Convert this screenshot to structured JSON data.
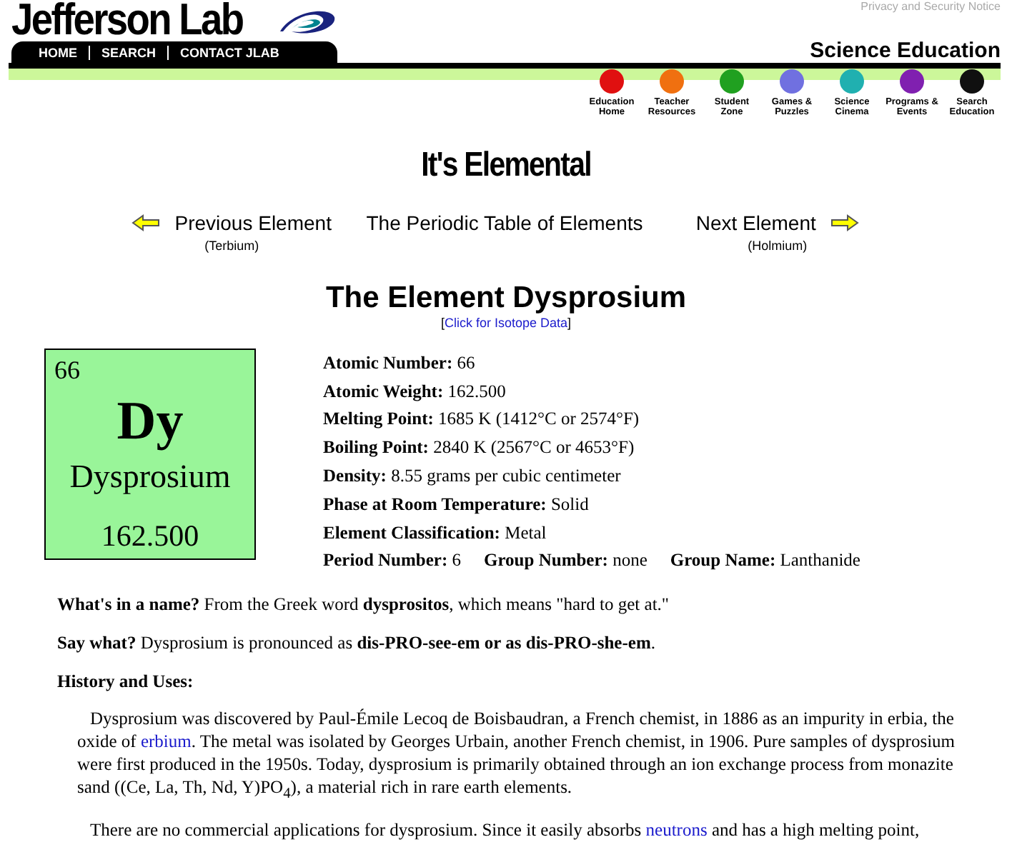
{
  "header": {
    "logo": "Jefferson Lab",
    "privacy_link": "Privacy and Security Notice",
    "nav": [
      {
        "label": "HOME"
      },
      {
        "label": "SEARCH"
      },
      {
        "label": "CONTACT JLAB"
      }
    ],
    "section_title": "Science Education",
    "icon_links": [
      {
        "label": "Education Home",
        "color": "#e01010"
      },
      {
        "label": "Teacher Resources",
        "color": "#f07010"
      },
      {
        "label": "Student Zone",
        "color": "#20a020"
      },
      {
        "label": "Games & Puzzles",
        "color": "#7070e0"
      },
      {
        "label": "Science Cinema",
        "color": "#20b0b0"
      },
      {
        "label": "Programs & Events",
        "color": "#8020b0"
      },
      {
        "label": "Search Education",
        "color": "#101010"
      }
    ]
  },
  "page_title": "It's Elemental",
  "element_nav": {
    "previous": {
      "label": "Previous Element",
      "sub": "(Terbium)"
    },
    "center": "The Periodic Table of Elements",
    "next": {
      "label": "Next Element",
      "sub": "(Holmium)"
    }
  },
  "heading": "The Element Dysprosium",
  "isotope": {
    "open": "[",
    "link": "Click for Isotope Data",
    "close": "]"
  },
  "card": {
    "number": "66",
    "symbol": "Dy",
    "name": "Dysprosium",
    "weight": "162.500"
  },
  "facts": [
    [
      {
        "label": "Atomic Number:",
        "value": "66"
      }
    ],
    [
      {
        "label": "Atomic Weight:",
        "value": "162.500"
      }
    ],
    [
      {
        "label": "Melting Point:",
        "value": "1685 K (1412°C or 2574°F)"
      }
    ],
    [
      {
        "label": "Boiling Point:",
        "value": "2840 K (2567°C or 4653°F)"
      }
    ],
    [
      {
        "label": "Density:",
        "value": "8.55 grams per cubic centimeter"
      }
    ],
    [
      {
        "label": "Phase at Room Temperature:",
        "value": "Solid"
      }
    ],
    [
      {
        "label": "Element Classification:",
        "value": "Metal"
      }
    ],
    [
      {
        "label": "Period Number:",
        "value": "6"
      },
      {
        "label": "Group Number:",
        "value": "none"
      },
      {
        "label": "Group Name:",
        "value": "Lanthanide"
      }
    ]
  ],
  "body": [
    {
      "kind": "line",
      "text": "**What's in a name?** From the Greek word **dysprositos**, which means \"hard to get at.\""
    },
    {
      "kind": "line",
      "text": "**Say what?** Dysprosium is pronounced as **dis-PRO-see-em or as dis-PRO-she-em**."
    },
    {
      "kind": "heading",
      "text": "History and Uses:"
    },
    {
      "kind": "para",
      "segments": [
        {
          "kind": "text",
          "text": "Dysprosium was discovered by Paul-Émile Lecoq de Boisbaudran, a French chemist, in 1886 as an impurity in erbia, the oxide of "
        },
        {
          "kind": "link",
          "text": "erbium"
        },
        {
          "kind": "text",
          "text": ". The metal was isolated by Georges Urbain, another French chemist, in 1906. Pure samples of dysprosium were first produced in the 1950s. Today, dysprosium is primarily obtained through an ion exchange process from monazite sand ((Ce, La, Th, Nd, Y)PO$_{4}$), a material rich in rare earth elements."
        }
      ]
    },
    {
      "kind": "para",
      "segments": [
        {
          "kind": "text",
          "text": "There are no commercial applications for dysprosium. Since it easily absorbs "
        },
        {
          "kind": "link",
          "text": "neutrons"
        },
        {
          "kind": "text",
          "text": " and has a high melting point,"
        }
      ]
    }
  ]
}
